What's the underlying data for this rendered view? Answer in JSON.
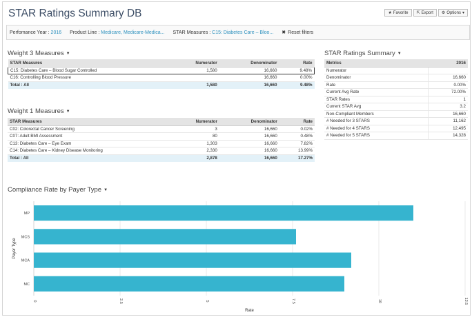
{
  "header": {
    "title": "STAR Ratings Summary DB",
    "favorite_label": "Favorite",
    "export_label": "Export",
    "options_label": "Options",
    "favorite_icon": "star-icon",
    "export_icon": "export-icon",
    "options_icon": "gear-icon"
  },
  "filters": {
    "year_label": "Perfomance Year :",
    "year_value": "2016",
    "product_label": "Product Line :",
    "product_value": "Medicare, Medicare-Medica...",
    "measures_label": "STAR Measures :",
    "measures_value": "C15: Diabetes Care – Bloo...",
    "reset_label": "Reset filters"
  },
  "weight3": {
    "title": "Weight 3 Measures",
    "columns": [
      "STAR Measures",
      "Numerator",
      "Denominator",
      "Rate"
    ],
    "rows": [
      [
        "C15: Diabetes Care – Blood Sugar Controlled",
        "1,580",
        "16,660",
        "9.48%"
      ],
      [
        "C16: Controlling Blood Pressure",
        "",
        "16,660",
        "0.00%"
      ]
    ],
    "total": [
      "Total : All",
      "1,580",
      "16,660",
      "9.48%"
    ]
  },
  "weight1": {
    "title": "Weight 1 Measures",
    "columns": [
      "STAR Measures",
      "Numerator",
      "Denominator",
      "Rate"
    ],
    "rows": [
      [
        "C02: Colorectal Cancer Screening",
        "3",
        "16,660",
        "0.02%"
      ],
      [
        "C07: Adult BMI Assessment",
        "80",
        "16,660",
        "0.48%"
      ],
      [
        "C13: Diabetes Care – Eye Exam",
        "1,303",
        "16,660",
        "7.82%"
      ],
      [
        "C14: Diabetes Care – Kidney Disease Monitoring",
        "2,330",
        "16,660",
        "13.99%"
      ]
    ],
    "total": [
      "Total : All",
      "2,878",
      "16,660",
      "17.27%"
    ]
  },
  "summary": {
    "title": "STAR Ratings Summary",
    "columns": [
      "Metrics",
      "2016"
    ],
    "rows": [
      [
        "Numerator",
        ""
      ],
      [
        "Denominator",
        "16,660"
      ],
      [
        "Rate",
        "0.00%"
      ],
      [
        "Current Avg Rate",
        "72.00%"
      ],
      [
        "STAR Rates",
        "1"
      ],
      [
        "Current STAR Avg",
        "3.2"
      ],
      [
        "Non-Compliant Members",
        "16,660"
      ],
      [
        "# Needed for 3 STARS",
        "11,162"
      ],
      [
        "# Needed for 4 STARS",
        "12,495"
      ],
      [
        "# Needed for 5 STARS",
        "14,328"
      ]
    ]
  },
  "chart_data": {
    "type": "bar",
    "orientation": "horizontal",
    "title": "Compliance Rate by Payer Type",
    "xlabel": "Rate",
    "ylabel": "Payer Type",
    "categories": [
      "MP",
      "MCS",
      "MCA",
      "MC"
    ],
    "values": [
      11.0,
      7.6,
      9.2,
      9.0
    ],
    "xlim": [
      0,
      12.5
    ],
    "xticks": [
      "0",
      "2.5",
      "5",
      "7.5",
      "10",
      "12.5"
    ],
    "bar_color": "#36b4cf",
    "grid": true
  }
}
